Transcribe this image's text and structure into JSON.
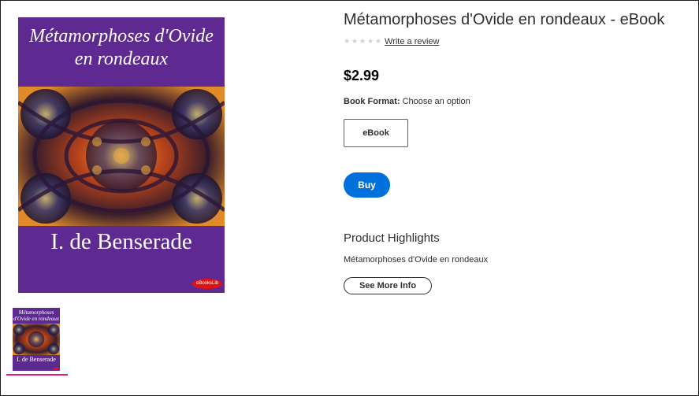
{
  "cover": {
    "title": "Métamorphoses d'Ovide en rondeaux",
    "author": "I. de Benserade",
    "badge": "eBooksLib",
    "background_color": "#5e2a91"
  },
  "thumbnail": {
    "title": "Métamorphoses d'Ovide en rondeaux",
    "author": "I. de Benserade",
    "selected_underline_color": "#d91a78"
  },
  "product": {
    "title": "Métamorphoses d'Ovide en rondeaux - eBook",
    "rating_stars": 0,
    "write_review_label": "Write a review",
    "price": "$2.99",
    "format_label": "Book Format:",
    "format_value": "Choose an option",
    "format_options": [
      "eBook"
    ],
    "buy_label": "Buy",
    "buy_color": "#0071dc"
  },
  "highlights": {
    "title": "Product Highlights",
    "text": "Métamorphoses d'Ovide en rondeaux",
    "more_label": "See More Info"
  }
}
